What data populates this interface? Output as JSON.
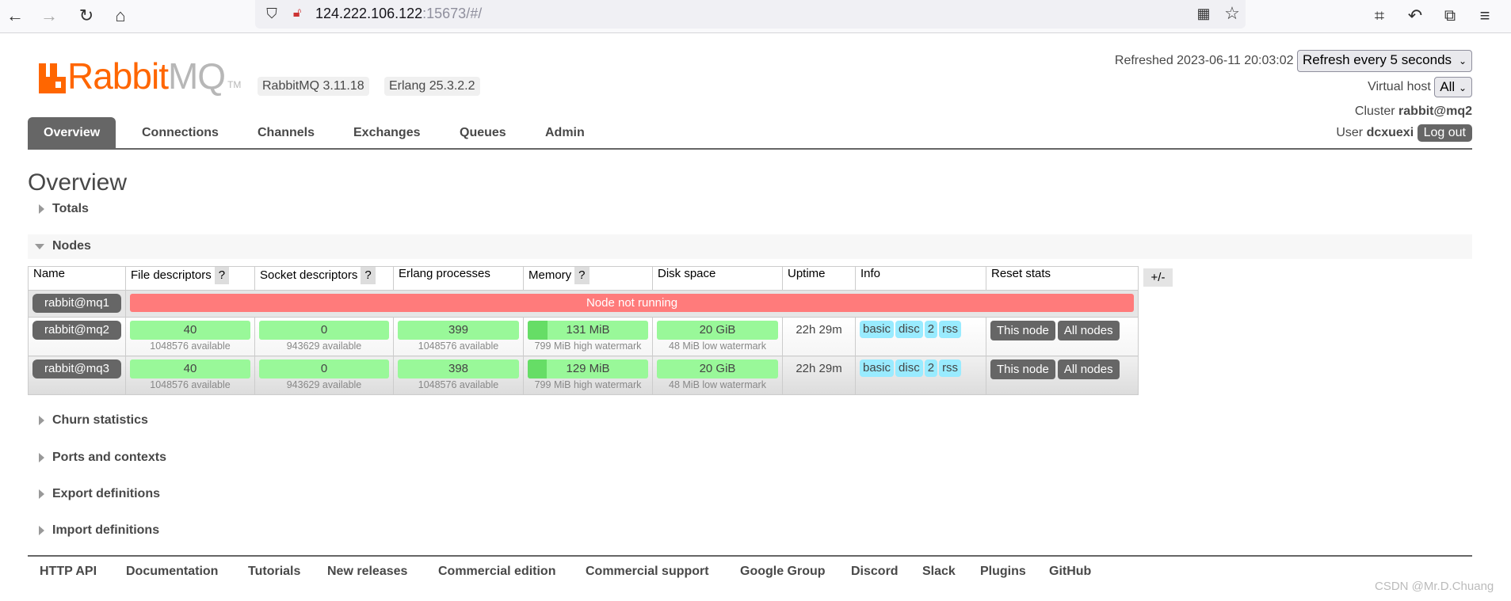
{
  "browser": {
    "url_host": "124.222.106.122",
    "url_rest": ":15673/#/"
  },
  "header": {
    "logo_text": "RabbitMQ",
    "version_badge": "RabbitMQ 3.11.18",
    "erlang_badge": "Erlang 25.3.2.2",
    "refreshed_label": "Refreshed 2023-06-11 20:03:02",
    "refresh_select": "Refresh every 5 seconds",
    "vhost_label": "Virtual host",
    "vhost_select": "All",
    "cluster_label": "Cluster",
    "cluster_name": "rabbit@mq2",
    "user_label": "User",
    "user_name": "dcxuexi",
    "logout": "Log out"
  },
  "nav": {
    "tabs": [
      "Overview",
      "Connections",
      "Channels",
      "Exchanges",
      "Queues",
      "Admin"
    ],
    "active": "Overview"
  },
  "page_title": "Overview",
  "sections": {
    "totals": "Totals",
    "nodes": "Nodes",
    "churn": "Churn statistics",
    "ports": "Ports and contexts",
    "export": "Export definitions",
    "import": "Import definitions"
  },
  "nodes_table": {
    "headers": [
      "Name",
      "File descriptors",
      "Socket descriptors",
      "Erlang processes",
      "Memory",
      "Disk space",
      "Uptime",
      "Info",
      "Reset stats"
    ],
    "help": "?",
    "plus_minus": "+/-",
    "down_node": {
      "name": "rabbit@mq1",
      "status": "Node not running"
    },
    "rows": [
      {
        "name": "rabbit@mq2",
        "fd": "40",
        "fd_sub": "1048576 available",
        "sd": "0",
        "sd_sub": "943629 available",
        "ep": "399",
        "ep_sub": "1048576 available",
        "mem": "131 MiB",
        "mem_sub": "799 MiB high watermark",
        "mem_fraction": 0.164,
        "disk": "20 GiB",
        "disk_sub": "48 MiB low watermark",
        "uptime": "22h 29m",
        "info": [
          "basic",
          "disc",
          "2",
          "rss"
        ],
        "reset": [
          "This node",
          "All nodes"
        ]
      },
      {
        "name": "rabbit@mq3",
        "fd": "40",
        "fd_sub": "1048576 available",
        "sd": "0",
        "sd_sub": "943629 available",
        "ep": "398",
        "ep_sub": "1048576 available",
        "mem": "129 MiB",
        "mem_sub": "799 MiB high watermark",
        "mem_fraction": 0.161,
        "disk": "20 GiB",
        "disk_sub": "48 MiB low watermark",
        "uptime": "22h 29m",
        "info": [
          "basic",
          "disc",
          "2",
          "rss"
        ],
        "reset": [
          "This node",
          "All nodes"
        ]
      }
    ]
  },
  "footer": [
    "HTTP API",
    "Documentation",
    "Tutorials",
    "New releases",
    "Commercial edition",
    "Commercial support",
    "Google Group",
    "Discord",
    "Slack",
    "Plugins",
    "GitHub"
  ],
  "watermark": "CSDN @Mr.D.Chuang",
  "colors": {
    "brand": "#ff6600",
    "ok": "#99f899",
    "down": "#ff7b7b",
    "info": "#99ebff",
    "button": "#666666"
  }
}
